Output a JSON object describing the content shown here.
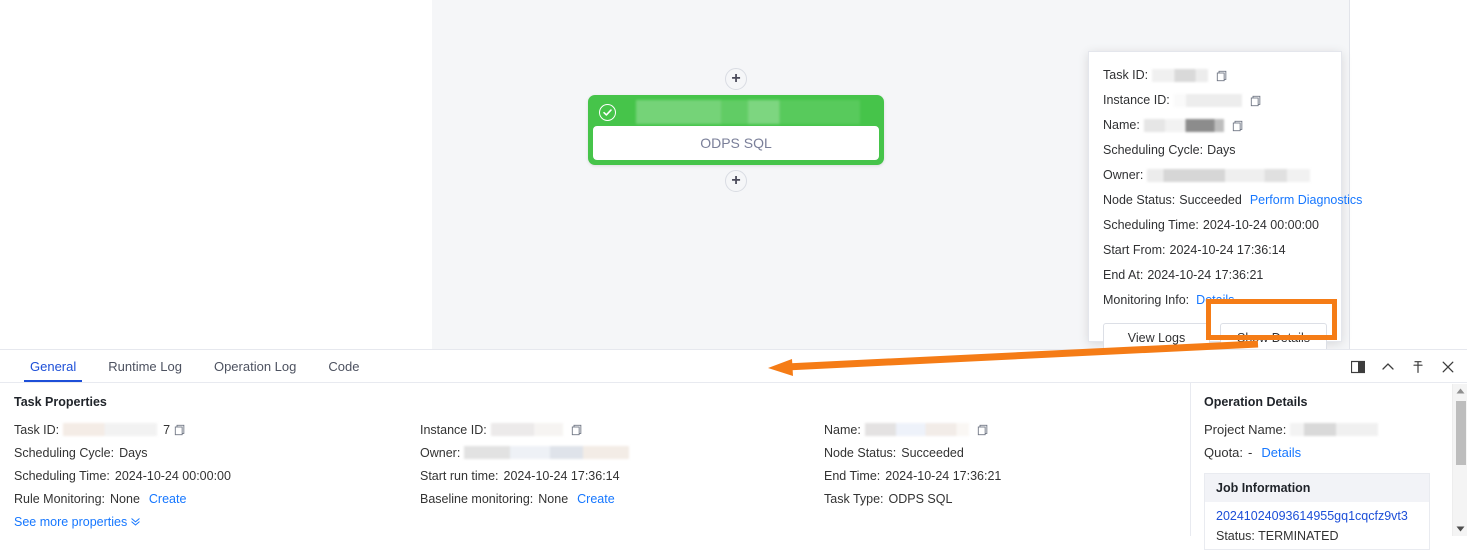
{
  "canvas": {
    "node": {
      "type_label": "ODPS SQL",
      "status_icon": "check-circle-icon",
      "add_upstream_label": "+",
      "add_downstream_label": "+"
    }
  },
  "popover": {
    "rows": [
      {
        "label": "Task ID:",
        "value": "",
        "redacted": true,
        "copy": true
      },
      {
        "label": "Instance ID:",
        "value": "",
        "redacted": true,
        "copy": true
      },
      {
        "label": "Name:",
        "value": "",
        "redacted": true,
        "copy": true
      },
      {
        "label": "Scheduling Cycle:",
        "value": "Days",
        "redacted": false,
        "copy": false
      },
      {
        "label": "Owner:",
        "value": "",
        "redacted": true,
        "copy": false
      },
      {
        "label": "Node Status:",
        "value": "Succeeded",
        "link": "Perform Diagnostics"
      },
      {
        "label": "Scheduling Time:",
        "value": "2024-10-24 00:00:00"
      },
      {
        "label": "Start From:",
        "value": "2024-10-24 17:36:14"
      },
      {
        "label": "End At:",
        "value": "2024-10-24 17:36:21"
      },
      {
        "label": "Monitoring Info:",
        "link": "Details"
      }
    ],
    "task_id_label": "Task ID:",
    "instance_id_label": "Instance ID:",
    "name_label": "Name:",
    "scheduling_cycle_label": "Scheduling Cycle:",
    "scheduling_cycle_value": "Days",
    "owner_label": "Owner:",
    "node_status_label": "Node Status:",
    "node_status_value": "Succeeded",
    "perform_diagnostics_link": "Perform Diagnostics",
    "scheduling_time_label": "Scheduling Time:",
    "scheduling_time_value": "2024-10-24 00:00:00",
    "start_from_label": "Start From:",
    "start_from_value": "2024-10-24 17:36:14",
    "end_at_label": "End At:",
    "end_at_value": "2024-10-24 17:36:21",
    "monitoring_info_label": "Monitoring Info:",
    "monitoring_info_link": "Details",
    "view_logs_button": "View Logs",
    "show_details_button": "Show Details"
  },
  "annotation": {
    "highlight_color": "#f57c16",
    "arrow_color": "#f57c16",
    "highlight_target": "Show Details"
  },
  "bottom_panel": {
    "tabs": [
      {
        "label": "General",
        "active": true
      },
      {
        "label": "Runtime Log",
        "active": false
      },
      {
        "label": "Operation Log",
        "active": false
      },
      {
        "label": "Code",
        "active": false
      }
    ],
    "window_tools": [
      {
        "name": "split-panel-icon"
      },
      {
        "name": "chevron-up-icon"
      },
      {
        "name": "pin-icon"
      },
      {
        "name": "close-icon"
      }
    ],
    "column1": {
      "section_title": "Task Properties",
      "task_id_label": "Task ID:",
      "task_id_suffix": "7",
      "scheduling_cycle_label": "Scheduling Cycle:",
      "scheduling_cycle_value": "Days",
      "scheduling_time_label": "Scheduling Time:",
      "scheduling_time_value": "2024-10-24 00:00:00",
      "rule_monitoring_label": "Rule Monitoring:",
      "rule_monitoring_value": "None",
      "rule_monitoring_link": "Create",
      "see_more_link": "See more properties"
    },
    "column2": {
      "instance_id_label": "Instance ID:",
      "owner_label": "Owner:",
      "start_run_time_label": "Start run time:",
      "start_run_time_value": "2024-10-24 17:36:14",
      "baseline_monitoring_label": "Baseline monitoring:",
      "baseline_monitoring_value": "None",
      "baseline_monitoring_link": "Create"
    },
    "column3": {
      "name_label": "Name:",
      "node_status_label": "Node Status:",
      "node_status_value": "Succeeded",
      "end_time_label": "End Time:",
      "end_time_value": "2024-10-24 17:36:21",
      "task_type_label": "Task Type:",
      "task_type_value": "ODPS SQL"
    },
    "right_column": {
      "section_title": "Operation Details",
      "project_name_label": "Project Name:",
      "quota_label": "Quota:",
      "quota_value": "-",
      "quota_link": "Details",
      "job_information_title": "Job Information",
      "job_id": "20241024093614955gq1cqcfz9vt3",
      "job_status_label": "Status:",
      "job_status_value": "TERMINATED"
    }
  }
}
